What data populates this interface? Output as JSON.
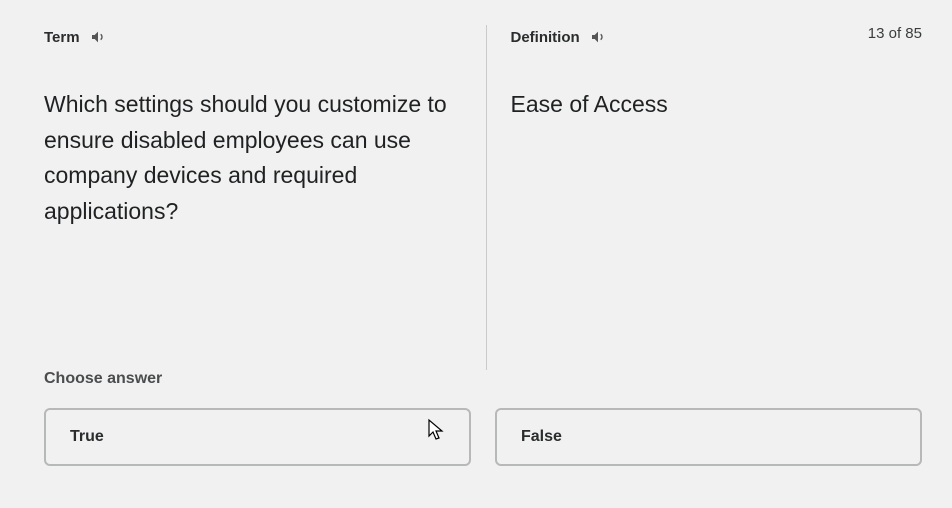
{
  "card": {
    "term_label": "Term",
    "definition_label": "Definition",
    "counter": "13 of 85",
    "term_text": "Which settings should you customize to ensure disabled employees can use company devices and required applications?",
    "definition_text": "Ease of Access"
  },
  "choose": {
    "label": "Choose answer",
    "options": [
      "True",
      "False"
    ]
  }
}
